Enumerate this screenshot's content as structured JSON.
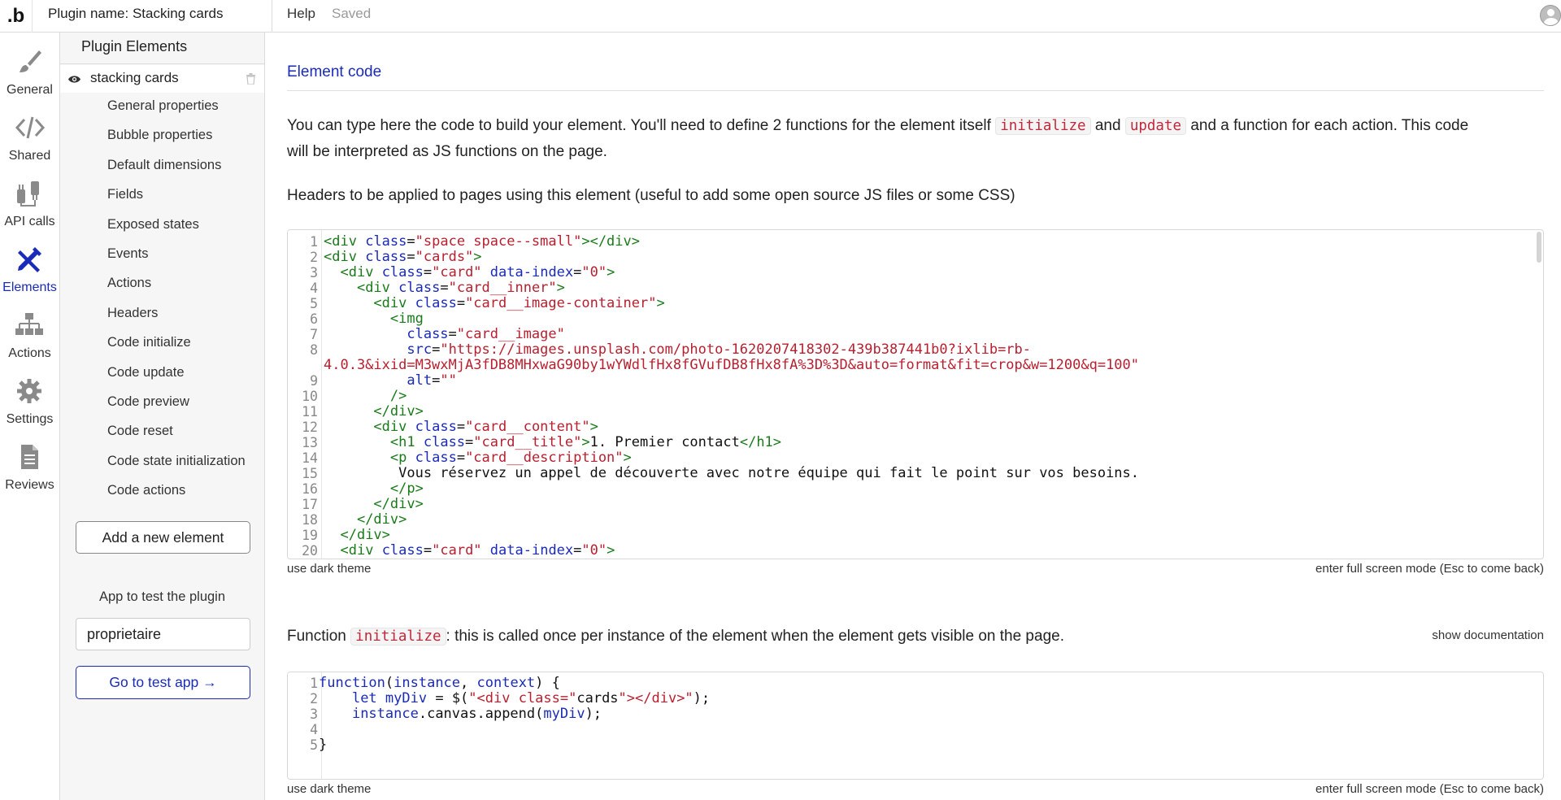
{
  "topbar": {
    "logo": ".b",
    "plugin_name": "Plugin name: Stacking cards",
    "help": "Help",
    "saved": "Saved"
  },
  "rail": {
    "items": [
      {
        "label": "General",
        "icon": "brush-icon"
      },
      {
        "label": "Shared",
        "icon": "code-icon"
      },
      {
        "label": "API calls",
        "icon": "plug-icon"
      },
      {
        "label": "Elements",
        "icon": "pencil-ruler-icon",
        "active": true
      },
      {
        "label": "Actions",
        "icon": "hierarchy-icon"
      },
      {
        "label": "Settings",
        "icon": "gear-icon"
      },
      {
        "label": "Reviews",
        "icon": "document-icon"
      }
    ]
  },
  "panel": {
    "title": "Plugin Elements",
    "element_name": "stacking cards",
    "sub_items": [
      "General properties",
      "Bubble properties",
      "Default dimensions",
      "Fields",
      "Exposed states",
      "Events",
      "Actions",
      "Headers",
      "Code initialize",
      "Code update",
      "Code preview",
      "Code reset",
      "Code state initialization",
      "Code actions"
    ],
    "add_button": "Add a new element",
    "test_label": "App to test the plugin",
    "test_app_value": "proprietaire",
    "go_button": "Go to test app →"
  },
  "main": {
    "section_title": "Element code",
    "intro_before": "You can type here the code to build your element. You'll need to define 2 functions for the element itself",
    "intro_chip1": "initialize",
    "intro_and": "and",
    "intro_chip2": "update",
    "intro_after": "and a function for each action. This code",
    "intro_line2": "will be interpreted as JS functions on the page.",
    "headers_text": "Headers to be applied to pages using this element (useful to add some open source JS files or some CSS)",
    "editor1_line_numbers": [
      "1",
      "2",
      "3",
      "4",
      "5",
      "6",
      "7",
      "8",
      "",
      "9",
      "10",
      "11",
      "12",
      "13",
      "14",
      "15",
      "16",
      "17",
      "18",
      "19",
      "20"
    ],
    "editor1_footer_left": "use dark theme",
    "editor1_footer_right": "enter full screen mode (Esc to come back)",
    "function_label": "Function",
    "function_chip": "initialize",
    "function_desc": ": this is called once per instance of the element when the element gets visible on the page.",
    "show_documentation": "show documentation",
    "editor2_line_numbers": [
      "1",
      "2",
      "3",
      "4",
      "5"
    ],
    "editor2_footer_left": "use dark theme",
    "editor2_footer_right": "enter full screen mode (Esc to come back)"
  }
}
